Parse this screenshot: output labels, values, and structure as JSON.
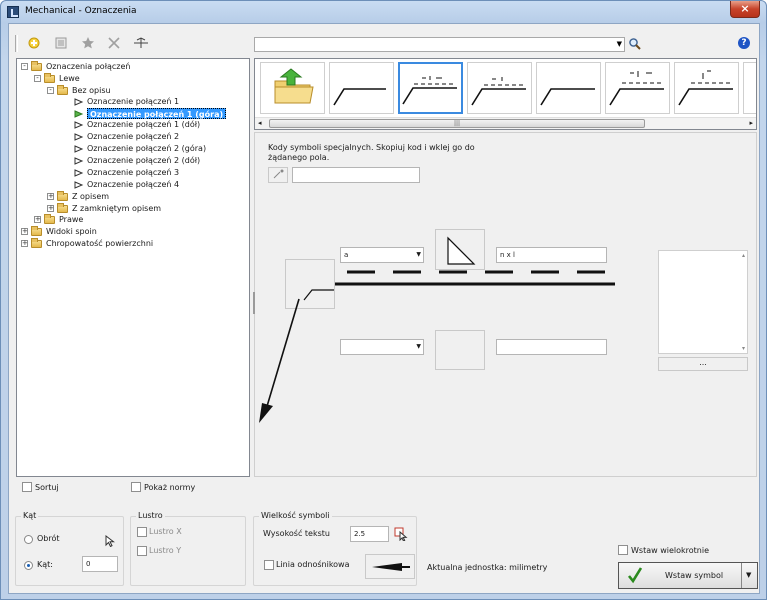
{
  "window": {
    "title": "Mechanical - Oznaczenia",
    "close": "×"
  },
  "toolbar": {
    "help": "?"
  },
  "tree": {
    "root": "Oznaczenia połączeń",
    "lewe": "Lewe",
    "bez_opisu": "Bez opisu",
    "items": [
      "Oznaczenie połączeń 1",
      "Oznaczenie połączeń 1 (góra)",
      "Oznaczenie połączeń 1 (dół)",
      "Oznaczenie połączeń 2",
      "Oznaczenie połączeń 2 (góra)",
      "Oznaczenie połączeń 2 (dół)",
      "Oznaczenie połączeń 3",
      "Oznaczenie połączeń 4"
    ],
    "z_opisem": "Z opisem",
    "z_zamknietym": "Z zamkniętym opisem",
    "prawe": "Prawe",
    "widoki": "Widoki spoin",
    "chropowatosc": "Chropowatość powierzchni"
  },
  "editor": {
    "hint": "Kody symboli specjalnych. Skopiuj kod i wklej go do żądanego pola.",
    "top_combo": "a",
    "top_field": "n x l",
    "more": "..."
  },
  "options": {
    "sortuj": "Sortuj",
    "pokaz_normy": "Pokaż normy",
    "kat_group": "Kąt",
    "obrot": "Obrót",
    "kat": "Kąt:",
    "kat_value": "0",
    "lustro_group": "Lustro",
    "lustro_x": "Lustro X",
    "lustro_y": "Lustro Y",
    "wielkosc_group": "Wielkość symboli",
    "wysokosc_label": "Wysokość tekstu",
    "wysokosc_value": "2.5",
    "linia": "Linia odnośnikowa",
    "jednostka": "Aktualna jednostka: milimetry",
    "wstaw_wielokrotnie": "Wstaw wielokrotnie",
    "wstaw_symbol": "Wstaw symbol"
  },
  "colors": {
    "accent": "#3399ff",
    "title_bg": "#bdd0e8",
    "close": "#c7432a"
  }
}
